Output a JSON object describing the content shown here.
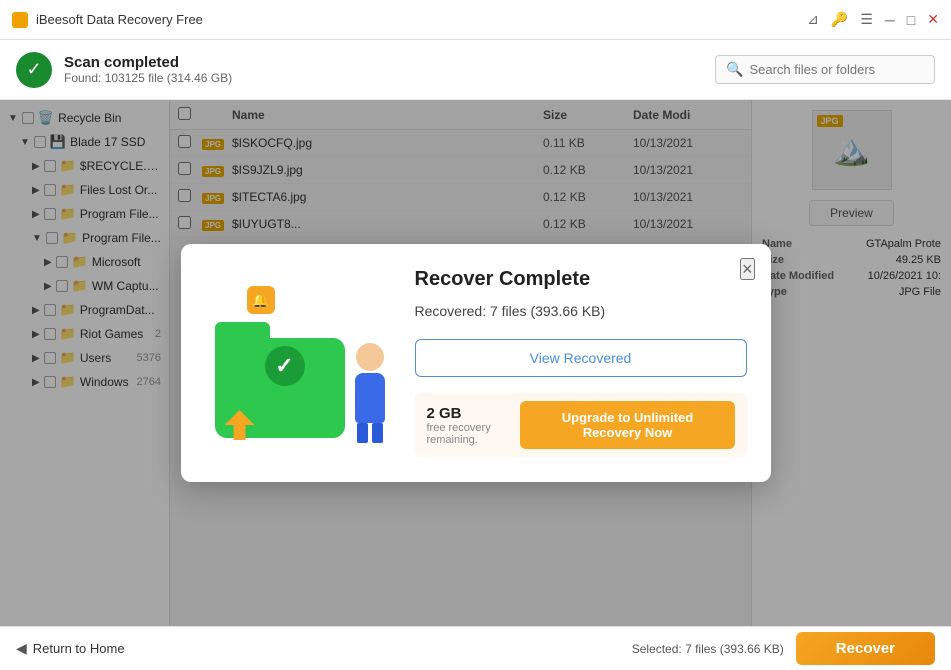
{
  "app": {
    "title": "iBeesoft Data Recovery Free"
  },
  "title_bar": {
    "icons": {
      "filter": "⊿",
      "key": "🔑",
      "menu": "☰",
      "minimize": "─",
      "maximize": "□",
      "close": "✕"
    }
  },
  "top_bar": {
    "scan_title": "Scan completed",
    "scan_subtitle": "Found: 103125 file (314.46 GB)",
    "search_placeholder": "Search files or folders"
  },
  "sidebar": {
    "items": [
      {
        "label": "Recycle Bin",
        "indent": 0,
        "count": "",
        "expanded": true
      },
      {
        "label": "Blade 17 SSD",
        "indent": 1,
        "count": "",
        "expanded": true
      },
      {
        "label": "$RECYCLE.BI...",
        "indent": 2,
        "count": "",
        "expanded": false
      },
      {
        "label": "Files Lost Or...",
        "indent": 2,
        "count": "",
        "expanded": false
      },
      {
        "label": "Program File...",
        "indent": 2,
        "count": "",
        "expanded": false
      },
      {
        "label": "Program File...",
        "indent": 2,
        "count": "",
        "expanded": true
      },
      {
        "label": "Microsoft",
        "indent": 3,
        "count": "",
        "expanded": false
      },
      {
        "label": "WM Captu...",
        "indent": 3,
        "count": "",
        "expanded": false
      },
      {
        "label": "ProgramDat...",
        "indent": 2,
        "count": "",
        "expanded": false
      },
      {
        "label": "Riot Games",
        "indent": 2,
        "count": "2",
        "expanded": false
      },
      {
        "label": "Users",
        "indent": 2,
        "count": "5376",
        "expanded": false
      },
      {
        "label": "Windows",
        "indent": 2,
        "count": "2764",
        "expanded": false
      }
    ]
  },
  "file_list": {
    "headers": [
      "",
      "",
      "Name",
      "Size",
      "Date Modi"
    ],
    "rows": [
      {
        "name": "$ISKOCFQ.jpg",
        "size": "0.11 KB",
        "date": "10/13/2021",
        "type": "JPG"
      },
      {
        "name": "$IS9JZL9.jpg",
        "size": "0.12 KB",
        "date": "10/13/2021",
        "type": "JPG"
      },
      {
        "name": "$ITECTA6.jpg",
        "size": "0.12 KB",
        "date": "10/13/2021",
        "type": "JPG"
      },
      {
        "name": "$IUYUGT8...",
        "size": "0.12 KB",
        "date": "10/13/2021",
        "type": "JPG"
      }
    ]
  },
  "preview": {
    "button_label": "Preview",
    "meta": {
      "name_label": "Name",
      "name_value": "GTApalm Prote",
      "size_label": "Size",
      "size_value": "49.25 KB",
      "date_label": "Date Modified",
      "date_value": "10/26/2021 10:",
      "type_label": "Type",
      "type_value": "JPG File"
    }
  },
  "bottom_bar": {
    "return_label": "Return to Home",
    "selected_info": "Selected: 7 files (393.66 KB)",
    "recover_label": "Recover"
  },
  "dialog": {
    "title": "Recover Complete",
    "description": "Recovered: 7 files (393.66 KB)",
    "view_btn_label": "View Recovered",
    "close_label": "×",
    "free_gb": "2 GB",
    "free_label": "free recovery remaining.",
    "upgrade_label": "Upgrade to Unlimited Recovery Now"
  }
}
